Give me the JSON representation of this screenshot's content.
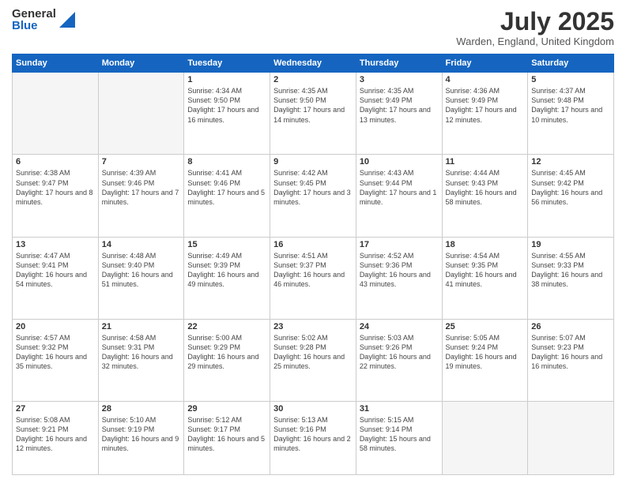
{
  "logo": {
    "general": "General",
    "blue": "Blue"
  },
  "title": "July 2025",
  "subtitle": "Warden, England, United Kingdom",
  "days_of_week": [
    "Sunday",
    "Monday",
    "Tuesday",
    "Wednesday",
    "Thursday",
    "Friday",
    "Saturday"
  ],
  "weeks": [
    [
      {
        "day": "",
        "info": ""
      },
      {
        "day": "",
        "info": ""
      },
      {
        "day": "1",
        "info": "Sunrise: 4:34 AM\nSunset: 9:50 PM\nDaylight: 17 hours and 16 minutes."
      },
      {
        "day": "2",
        "info": "Sunrise: 4:35 AM\nSunset: 9:50 PM\nDaylight: 17 hours and 14 minutes."
      },
      {
        "day": "3",
        "info": "Sunrise: 4:35 AM\nSunset: 9:49 PM\nDaylight: 17 hours and 13 minutes."
      },
      {
        "day": "4",
        "info": "Sunrise: 4:36 AM\nSunset: 9:49 PM\nDaylight: 17 hours and 12 minutes."
      },
      {
        "day": "5",
        "info": "Sunrise: 4:37 AM\nSunset: 9:48 PM\nDaylight: 17 hours and 10 minutes."
      }
    ],
    [
      {
        "day": "6",
        "info": "Sunrise: 4:38 AM\nSunset: 9:47 PM\nDaylight: 17 hours and 8 minutes."
      },
      {
        "day": "7",
        "info": "Sunrise: 4:39 AM\nSunset: 9:46 PM\nDaylight: 17 hours and 7 minutes."
      },
      {
        "day": "8",
        "info": "Sunrise: 4:41 AM\nSunset: 9:46 PM\nDaylight: 17 hours and 5 minutes."
      },
      {
        "day": "9",
        "info": "Sunrise: 4:42 AM\nSunset: 9:45 PM\nDaylight: 17 hours and 3 minutes."
      },
      {
        "day": "10",
        "info": "Sunrise: 4:43 AM\nSunset: 9:44 PM\nDaylight: 17 hours and 1 minute."
      },
      {
        "day": "11",
        "info": "Sunrise: 4:44 AM\nSunset: 9:43 PM\nDaylight: 16 hours and 58 minutes."
      },
      {
        "day": "12",
        "info": "Sunrise: 4:45 AM\nSunset: 9:42 PM\nDaylight: 16 hours and 56 minutes."
      }
    ],
    [
      {
        "day": "13",
        "info": "Sunrise: 4:47 AM\nSunset: 9:41 PM\nDaylight: 16 hours and 54 minutes."
      },
      {
        "day": "14",
        "info": "Sunrise: 4:48 AM\nSunset: 9:40 PM\nDaylight: 16 hours and 51 minutes."
      },
      {
        "day": "15",
        "info": "Sunrise: 4:49 AM\nSunset: 9:39 PM\nDaylight: 16 hours and 49 minutes."
      },
      {
        "day": "16",
        "info": "Sunrise: 4:51 AM\nSunset: 9:37 PM\nDaylight: 16 hours and 46 minutes."
      },
      {
        "day": "17",
        "info": "Sunrise: 4:52 AM\nSunset: 9:36 PM\nDaylight: 16 hours and 43 minutes."
      },
      {
        "day": "18",
        "info": "Sunrise: 4:54 AM\nSunset: 9:35 PM\nDaylight: 16 hours and 41 minutes."
      },
      {
        "day": "19",
        "info": "Sunrise: 4:55 AM\nSunset: 9:33 PM\nDaylight: 16 hours and 38 minutes."
      }
    ],
    [
      {
        "day": "20",
        "info": "Sunrise: 4:57 AM\nSunset: 9:32 PM\nDaylight: 16 hours and 35 minutes."
      },
      {
        "day": "21",
        "info": "Sunrise: 4:58 AM\nSunset: 9:31 PM\nDaylight: 16 hours and 32 minutes."
      },
      {
        "day": "22",
        "info": "Sunrise: 5:00 AM\nSunset: 9:29 PM\nDaylight: 16 hours and 29 minutes."
      },
      {
        "day": "23",
        "info": "Sunrise: 5:02 AM\nSunset: 9:28 PM\nDaylight: 16 hours and 25 minutes."
      },
      {
        "day": "24",
        "info": "Sunrise: 5:03 AM\nSunset: 9:26 PM\nDaylight: 16 hours and 22 minutes."
      },
      {
        "day": "25",
        "info": "Sunrise: 5:05 AM\nSunset: 9:24 PM\nDaylight: 16 hours and 19 minutes."
      },
      {
        "day": "26",
        "info": "Sunrise: 5:07 AM\nSunset: 9:23 PM\nDaylight: 16 hours and 16 minutes."
      }
    ],
    [
      {
        "day": "27",
        "info": "Sunrise: 5:08 AM\nSunset: 9:21 PM\nDaylight: 16 hours and 12 minutes."
      },
      {
        "day": "28",
        "info": "Sunrise: 5:10 AM\nSunset: 9:19 PM\nDaylight: 16 hours and 9 minutes."
      },
      {
        "day": "29",
        "info": "Sunrise: 5:12 AM\nSunset: 9:17 PM\nDaylight: 16 hours and 5 minutes."
      },
      {
        "day": "30",
        "info": "Sunrise: 5:13 AM\nSunset: 9:16 PM\nDaylight: 16 hours and 2 minutes."
      },
      {
        "day": "31",
        "info": "Sunrise: 5:15 AM\nSunset: 9:14 PM\nDaylight: 15 hours and 58 minutes."
      },
      {
        "day": "",
        "info": ""
      },
      {
        "day": "",
        "info": ""
      }
    ]
  ]
}
